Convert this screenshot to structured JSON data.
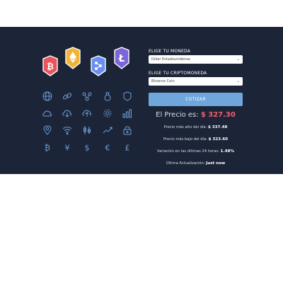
{
  "form": {
    "currency_label": "ELIGE TU MONEDA",
    "currency_value": "Dolar Estadounidense",
    "crypto_label": "ELIGE TU CRIPTOMONEDA",
    "crypto_value": "Binance Coin",
    "submit_label": "COTIZAR"
  },
  "result": {
    "price_label": "El Precio es:",
    "price_value": "$ 327.30",
    "high_label": "Precio más alto del día:",
    "high_value": "$ 337.48",
    "low_label": "Precio más bajo del día:",
    "low_value": "$ 323.60",
    "change_label": "Variación en las últimas 24 horas:",
    "change_value": "1.48%",
    "updated_label": "Última Actualización:",
    "updated_value": "Just now"
  },
  "colors": {
    "panel_bg": "#1c2537",
    "button": "#6fa7dc",
    "price_accent": "#f05d6c",
    "shield_bitcoin": "#e8555e",
    "shield_ethereum": "#f1b437",
    "shield_ripple": "#6a8ff2",
    "shield_litecoin": "#7b66d9",
    "icon_stroke": "#6e9fd9"
  },
  "illustration": {
    "shields": [
      "bitcoin-icon",
      "ethereum-icon",
      "ripple-icon",
      "litecoin-icon"
    ],
    "icons": [
      "globe-icon",
      "link-icon",
      "network-icon",
      "wallet-bag-icon",
      "shield-icon",
      "cloud-icon",
      "cloud-download-icon",
      "cloud-upload-icon",
      "gear-icon",
      "bar-chart-icon",
      "location-pin-icon",
      "wifi-icon",
      "candlestick-icon",
      "trend-up-icon",
      "lock-icon",
      "bitcoin-symbol-icon",
      "yen-symbol-icon",
      "dollar-symbol-icon",
      "euro-symbol-icon",
      "pound-symbol-icon"
    ]
  }
}
